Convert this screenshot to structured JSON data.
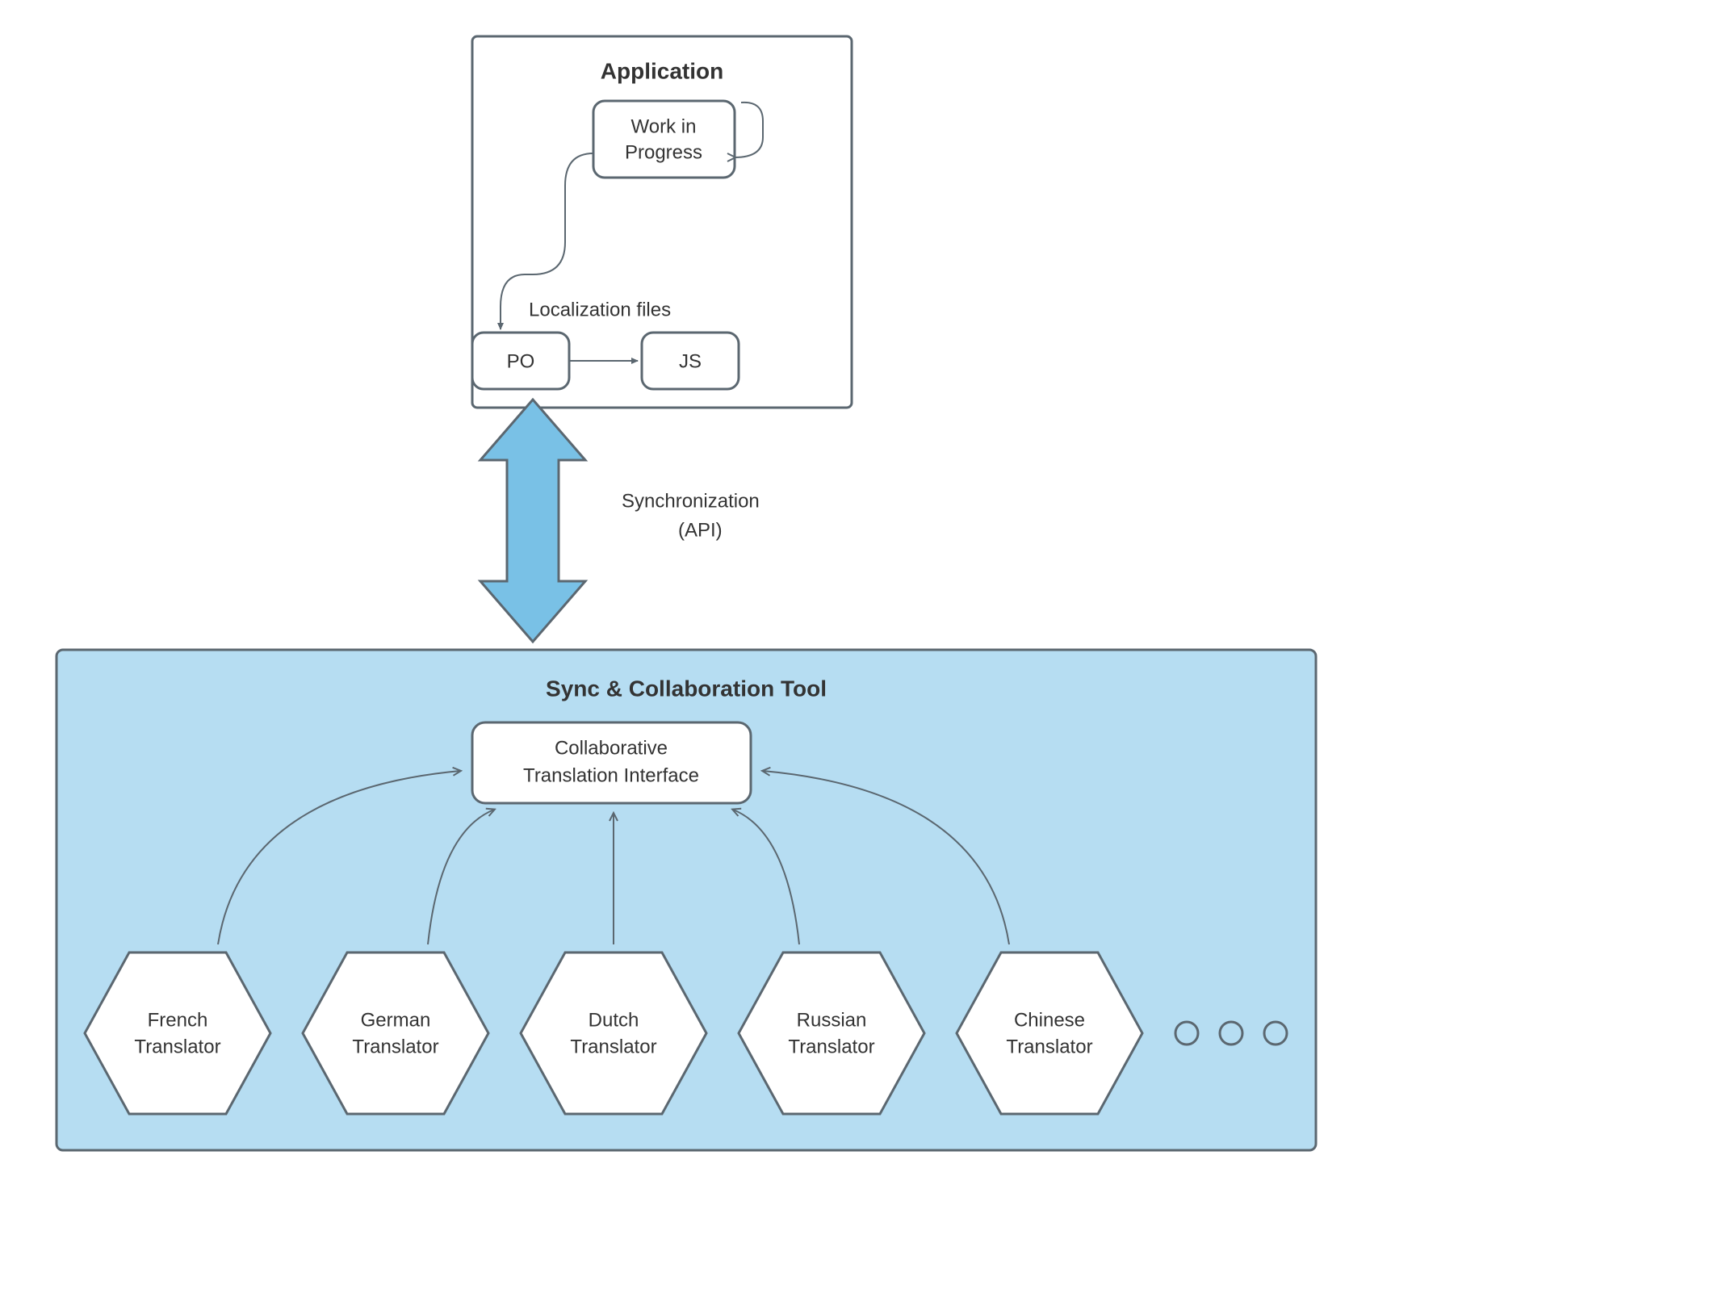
{
  "application": {
    "title": "Application",
    "wip_line1": "Work in",
    "wip_line2": "Progress",
    "localization_label": "Localization files",
    "po": "PO",
    "js": "JS"
  },
  "sync_label_line1": "Synchronization",
  "sync_label_line2": "(API)",
  "collab": {
    "title": "Sync & Collaboration Tool",
    "interface_line1": "Collaborative",
    "interface_line2": "Translation Interface",
    "translators": {
      "fr_line1": "French",
      "fr_line2": "Translator",
      "de_line1": "German",
      "de_line2": "Translator",
      "nl_line1": "Dutch",
      "nl_line2": "Translator",
      "ru_line1": "Russian",
      "ru_line2": "Translator",
      "zh_line1": "Chinese",
      "zh_line2": "Translator"
    }
  },
  "colors": {
    "stroke": "#5b6770",
    "panel_blue": "#b6ddf2",
    "arrow_blue": "#79c1e6"
  }
}
